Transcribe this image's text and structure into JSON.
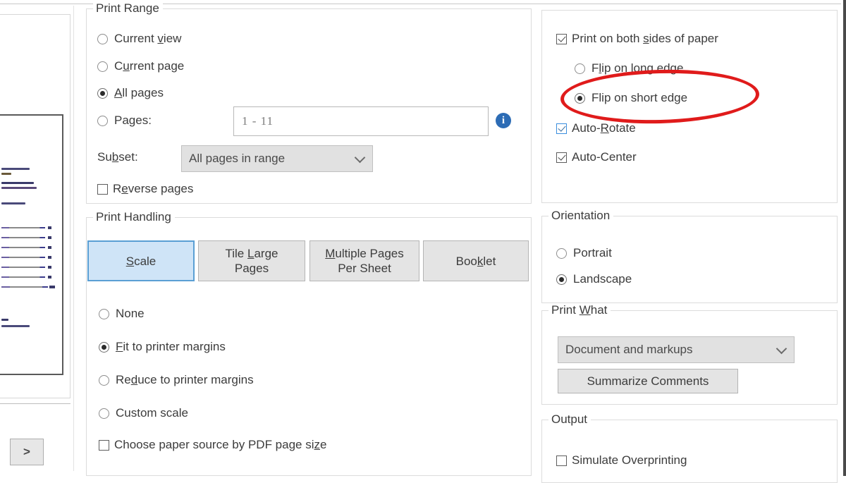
{
  "preview": {
    "nav_next_label": ">"
  },
  "print_range": {
    "title": "Print Range",
    "options": [
      {
        "label_pre": "Current ",
        "label_mnemonic": "v",
        "label_post": "iew",
        "checked": false,
        "name": "current-view"
      },
      {
        "label_pre": "C",
        "label_mnemonic": "u",
        "label_post": "rrent page",
        "checked": false,
        "name": "current-page"
      },
      {
        "label_pre": "",
        "label_mnemonic": "A",
        "label_post": "ll pages",
        "checked": true,
        "name": "all-pages"
      },
      {
        "label_pre": "Pa",
        "label_mnemonic": "g",
        "label_post": "es:",
        "checked": false,
        "name": "pages"
      }
    ],
    "pages_value": "1 - 11",
    "pages_placeholder": "1 - 11",
    "info_icon": "info-icon",
    "subset_label_pre": "Su",
    "subset_label_mnemonic": "b",
    "subset_label_post": "set:",
    "subset_value": "All pages in range",
    "reverse_pre": "R",
    "reverse_mnemonic": "e",
    "reverse_post": "verse pages",
    "reverse_checked": false
  },
  "print_handling": {
    "title": "Print Handling",
    "tabs": [
      {
        "line1_pre": "",
        "line1_mnemonic": "S",
        "line1_post": "cale",
        "line2": "",
        "selected": true,
        "name": "scale"
      },
      {
        "line1_pre": "Tile ",
        "line1_mnemonic": "L",
        "line1_post": "arge",
        "line2": "Pages",
        "selected": false,
        "name": "tile-large-pages"
      },
      {
        "line1_pre": "",
        "line1_mnemonic": "M",
        "line1_post": "ultiple Pages",
        "line2": "Per Sheet",
        "selected": false,
        "name": "multiple-pages-per-sheet"
      },
      {
        "line1_pre": "Boo",
        "line1_mnemonic": "k",
        "line1_post": "let",
        "line2": "",
        "selected": false,
        "name": "booklet"
      }
    ],
    "scale_options": [
      {
        "label_pre": "None",
        "label_mnemonic": "",
        "label_post": "",
        "checked": false,
        "name": "none"
      },
      {
        "label_pre": "",
        "label_mnemonic": "F",
        "label_post": "it to printer margins",
        "checked": true,
        "name": "fit-to-printer-margins"
      },
      {
        "label_pre": "Re",
        "label_mnemonic": "d",
        "label_post": "uce to printer margins",
        "checked": false,
        "name": "reduce-to-printer-margins"
      },
      {
        "label_pre": "Custom scale",
        "label_mnemonic": "",
        "label_post": "",
        "checked": false,
        "name": "custom-scale"
      }
    ],
    "paper_source_pre": "Choose paper source by PDF page si",
    "paper_source_mnemonic": "z",
    "paper_source_post": "e",
    "paper_source_checked": false
  },
  "duplex": {
    "both_sides_pre": "Print on both ",
    "both_sides_mnemonic": "s",
    "both_sides_post": "ides of paper",
    "both_sides_checked": true,
    "flip_long_pre": "F",
    "flip_long_mnemonic": "l",
    "flip_long_post": "ip on long edge",
    "flip_long_checked": false,
    "flip_short_label": "Flip on short edge",
    "flip_short_checked": true,
    "auto_rotate_pre": "Auto-",
    "auto_rotate_mnemonic": "R",
    "auto_rotate_post": "otate",
    "auto_rotate_checked": true,
    "auto_center_label": "Auto-Center",
    "auto_center_checked": true
  },
  "orientation": {
    "title": "Orientation",
    "portrait_label": "Portrait",
    "portrait_checked": false,
    "landscape_label": "Landscape",
    "landscape_checked": true
  },
  "print_what": {
    "title_pre": "Print ",
    "title_mnemonic": "W",
    "title_post": "hat",
    "selected_value": "Document and markups",
    "summarize_label": "Summarize Comments"
  },
  "output": {
    "title": "Output",
    "simulate_overprinting_label": "Simulate Overprinting",
    "simulate_overprinting_checked": false
  },
  "annotation": {
    "shape": "ellipse",
    "color": "#e01b1b",
    "targets": "Flip on short edge"
  },
  "colors": {
    "accent_blue": "#5a9fd4",
    "selected_tab_bg": "#cfe4f7",
    "annotation_red": "#e01b1b",
    "info_blue": "#2d6cb5",
    "text": "#3c3c3c"
  }
}
